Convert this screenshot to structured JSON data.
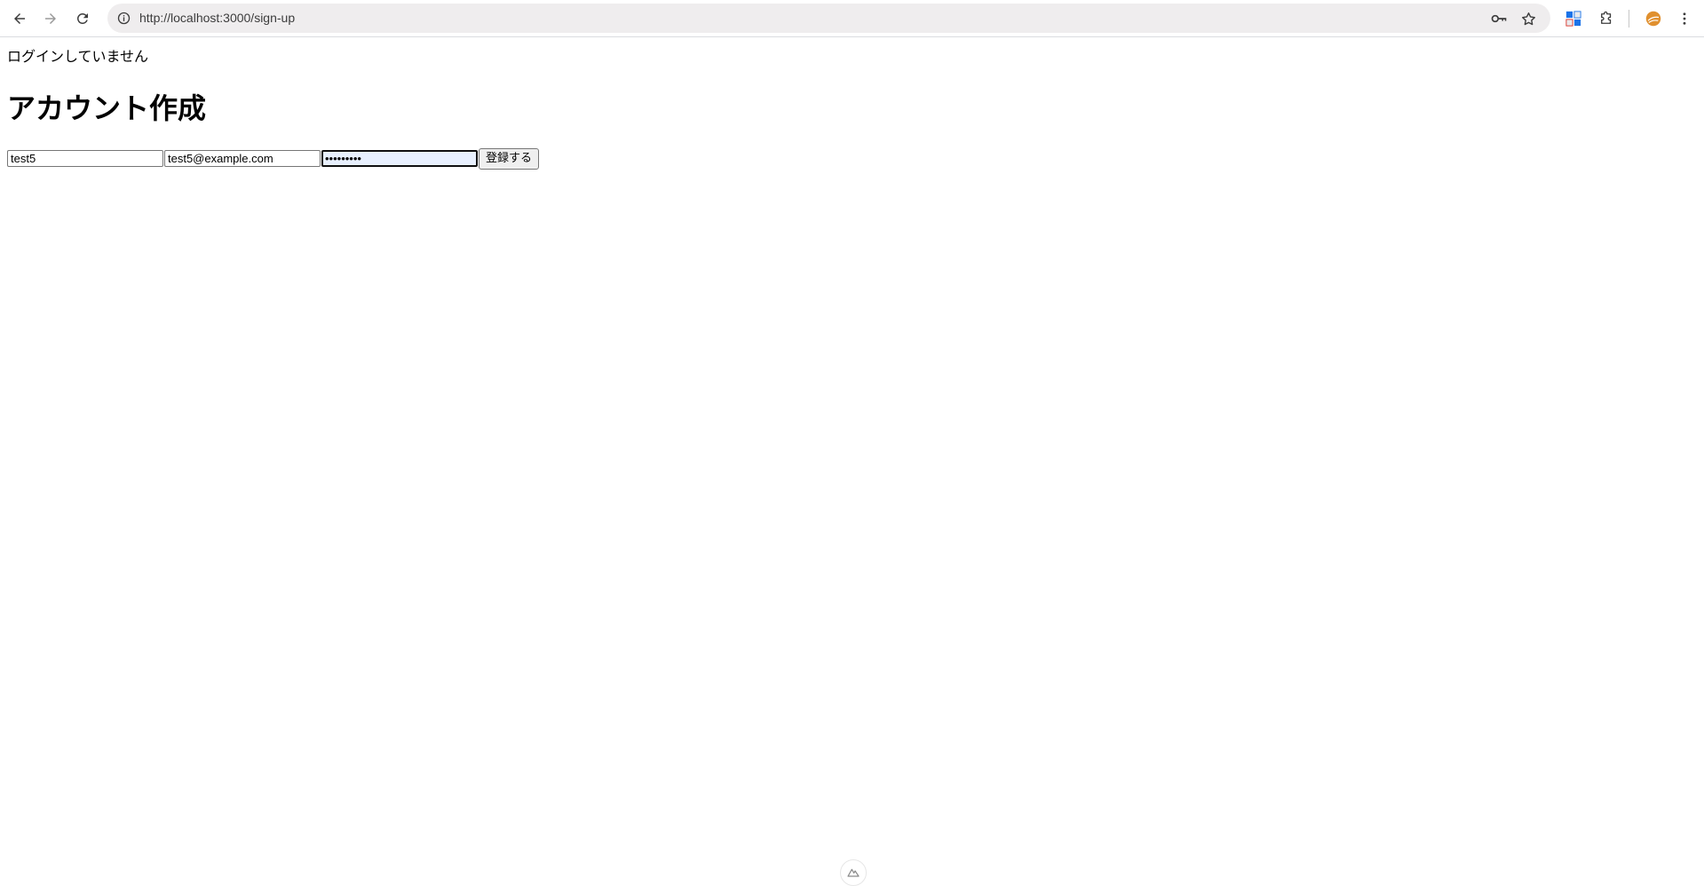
{
  "browser": {
    "url": "http://localhost:3000/sign-up",
    "icons": [
      "back-arrow-icon",
      "forward-arrow-icon",
      "reload-icon",
      "site-info-icon",
      "password-key-icon",
      "bookmark-star-icon",
      "translate-extension-icon",
      "extensions-puzzle-icon",
      "profile-avatar",
      "more-menu-icon"
    ],
    "avatar_color": "#e0902f"
  },
  "page": {
    "login_status": "ログインしていません",
    "title": "アカウント作成"
  },
  "form": {
    "username_value": "test5",
    "email_value": "test5@example.com",
    "password_mask": "•••••••••",
    "submit_label": "登録する"
  },
  "footer": {
    "icon": "nuxt-logo-icon"
  }
}
